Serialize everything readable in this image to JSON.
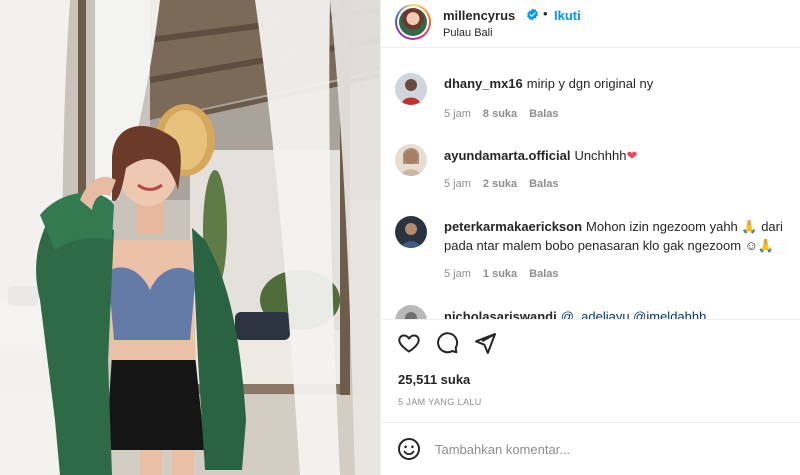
{
  "post": {
    "username": "millencyrus",
    "verified_icon": "verified-badge-icon",
    "separator": "•",
    "follow_label": "Ikuti",
    "location": "Pulau Bali"
  },
  "comments": [
    {
      "username": "dhany_mx16",
      "text": "mirip y dgn original ny",
      "age": "5 jam",
      "likes": "8 suka",
      "reply": "Balas"
    },
    {
      "username": "ayundamarta.official",
      "text": "Unchhhh",
      "heart": "❤",
      "age": "5 jam",
      "likes": "2 suka",
      "reply": "Balas"
    },
    {
      "username": "peterkarmakaerickson",
      "text": "Mohon izin ngezoom yahh 🙏 dari pada ntar malem bobo penasaran klo gak ngezoom ☺🙏",
      "age": "5 jam",
      "likes": "1 suka",
      "reply": "Balas"
    },
    {
      "username": "nicholasariswandi",
      "text": "@_adeliayu @imeldahhh"
    }
  ],
  "actions": {
    "icons": [
      "heart-icon",
      "comment-icon",
      "share-icon"
    ],
    "likes_count": "25,511 suka",
    "time_ago": "5 JAM YANG LALU"
  },
  "add_comment": {
    "icon": "emoji-icon",
    "placeholder": "Tambahkan komentar..."
  },
  "colors": {
    "accent": "#0095f6",
    "text": "#262626",
    "muted": "#8e8e8e",
    "heart": "#ed4956"
  }
}
